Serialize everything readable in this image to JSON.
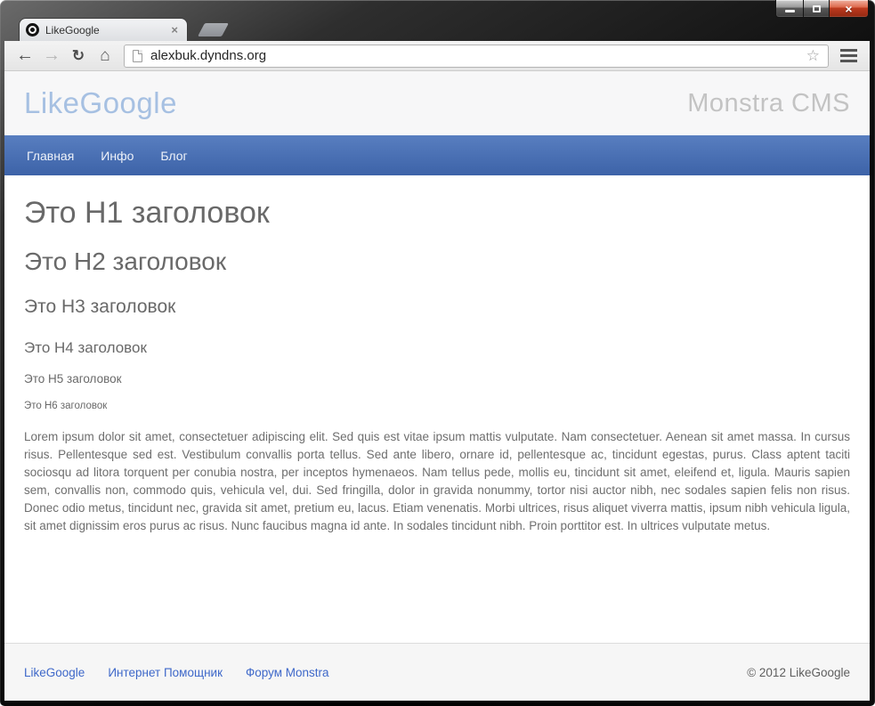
{
  "browser": {
    "tab": {
      "title": "LikeGoogle",
      "close_icon": "×"
    },
    "window_controls": {
      "close_icon": "×"
    },
    "toolbar": {
      "back_icon": "←",
      "forward_icon": "→",
      "reload_icon": "↻",
      "home_icon": "⌂",
      "url": "alexbuk.dyndns.org",
      "bookmark_icon": "☆"
    }
  },
  "page": {
    "header": {
      "brand": "LikeGoogle",
      "cms": "Monstra CMS"
    },
    "nav": {
      "items": [
        {
          "label": "Главная"
        },
        {
          "label": "Инфо"
        },
        {
          "label": "Блог"
        }
      ]
    },
    "content": {
      "headings": [
        {
          "level": "h1",
          "text": "Это H1 заголовок"
        },
        {
          "level": "h2",
          "text": "Это H2 заголовок"
        },
        {
          "level": "h3",
          "text": "Это H3 заголовок"
        },
        {
          "level": "h4",
          "text": "Это H4 заголовок"
        },
        {
          "level": "h5",
          "text": "Это H5 заголовок"
        },
        {
          "level": "h6",
          "text": "Это H6 заголовок"
        }
      ],
      "paragraph": "Lorem ipsum dolor sit amet, consectetuer adipiscing elit. Sed quis est vitae ipsum mattis vulputate. Nam consectetuer. Aenean sit amet massa. In cursus risus. Pellentesque sed est. Vestibulum convallis porta tellus. Sed ante libero, ornare id, pellentesque ac, tincidunt egestas, purus. Class aptent taciti sociosqu ad litora torquent per conubia nostra, per inceptos hymenaeos. Nam tellus pede, mollis eu, tincidunt sit amet, eleifend et, ligula. Mauris sapien sem, convallis non, commodo quis, vehicula vel, dui. Sed fringilla, dolor in gravida nonummy, tortor nisi auctor nibh, nec sodales sapien felis non risus. Donec odio metus, tincidunt nec, gravida sit amet, pretium eu, lacus. Etiam venenatis. Morbi ultrices, risus aliquet viverra mattis, ipsum nibh vehicula ligula, sit amet dignissim eros purus ac risus. Nunc faucibus magna id ante. In sodales tincidunt nibh. Proin porttitor est. In ultrices vulputate metus."
    },
    "footer": {
      "links": [
        {
          "label": "LikeGoogle"
        },
        {
          "label": "Интернет Помощник"
        },
        {
          "label": "Форум Monstra"
        }
      ],
      "copyright": "© 2012 LikeGoogle"
    },
    "colors": {
      "nav_blue_top": "#587ec0",
      "nav_blue_bottom": "#3d63a8",
      "brand_blue": "#a6c0e2",
      "link_blue": "#3e68c9",
      "heading_gray": "#696969"
    }
  }
}
